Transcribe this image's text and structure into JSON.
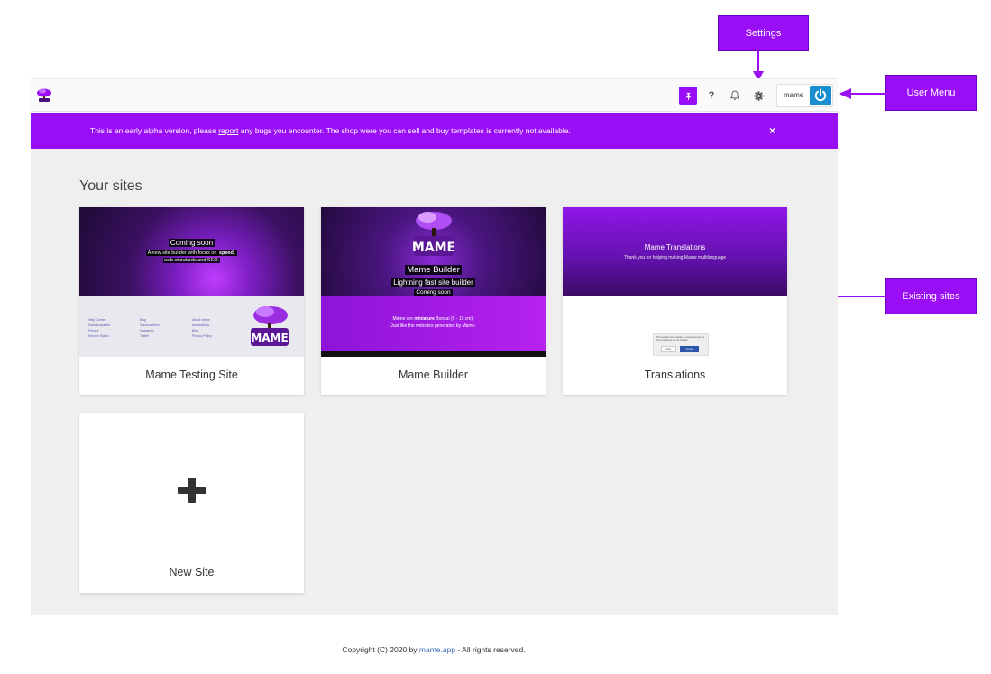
{
  "annotations": {
    "settings": "Settings",
    "user_menu": "User Menu",
    "existing_sites": "Existing sites"
  },
  "topbar": {
    "logo_icon": "mame-bonsai-logo",
    "pin_icon": "pin-icon",
    "help_label": "?",
    "bell_icon": "bell-icon",
    "gear_icon": "gear-icon",
    "username": "mame",
    "power_icon": "power-icon"
  },
  "alert": {
    "text_before": "This is an early alpha version, please ",
    "link_text": "report",
    "text_after": " any bugs you encounter. The shop were you can sell and buy templates is currently not available.",
    "close_label": "×"
  },
  "main": {
    "section_title": "Your sites",
    "sites": [
      {
        "label": "Mame Testing Site",
        "thumb": {
          "line1": "Coming soon",
          "line2_before": "A new site builder with focus on ",
          "line2_bold": "speed",
          "line2_after": ",",
          "line3": "web standards and SEO.",
          "footer_links": [
            "Help Center",
            "Blog",
            "About mame",
            "Docs/templates",
            "Stackoverflow",
            "Accessibility",
            "Privacy",
            "Instagram",
            "Blog",
            "Service Status",
            "Twitter",
            "Privacy Policy"
          ]
        }
      },
      {
        "label": "Mame Builder",
        "thumb": {
          "title": "Mame Builder",
          "subtitle": "Lightning fast site builder",
          "coming": "Coming soon",
          "band1_before": "Mame are ",
          "band1_bold": "miniature",
          "band1_after": " Bonsai (5 - 15 cm).",
          "band2": "Just like the websites generated by Mame."
        }
      },
      {
        "label": "Translations",
        "thumb": {
          "title": "Mame Translations",
          "subtitle": "Thank you for helping making Mame multilanguage",
          "cookie_text": "This website uses cookies to ensure you get the best experience on our website.",
          "cookie_decline": "Deny",
          "cookie_accept": "Accept"
        }
      }
    ],
    "new_site": {
      "label": "New Site",
      "icon": "plus-icon"
    }
  },
  "footer": {
    "text_before": "Copyright (C) 2020 by ",
    "link": "mame.app",
    "text_after": " - All rights reserved."
  },
  "colors": {
    "brand_purple": "#9a0ef5",
    "power_blue": "#1a8fd0",
    "link_blue": "#3b6fb5",
    "content_bg": "#efefef"
  }
}
